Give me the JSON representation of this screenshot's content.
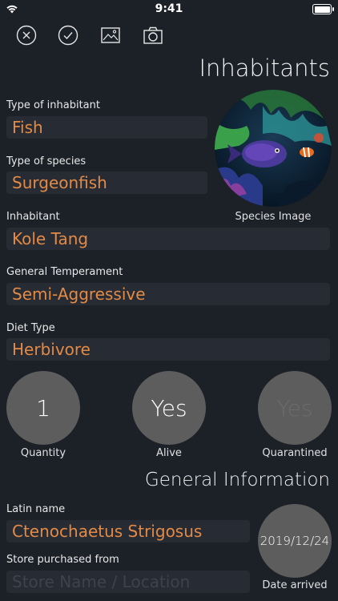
{
  "status_bar": {
    "time": "9:41"
  },
  "toolbar": {
    "icons": [
      "close-icon",
      "check-icon",
      "image-icon",
      "camera-icon"
    ]
  },
  "page": {
    "title": "Inhabitants"
  },
  "species_image": {
    "caption": "Species Image"
  },
  "fields": {
    "inhabitant_type": {
      "label": "Type of inhabitant",
      "value": "Fish"
    },
    "species_type": {
      "label": "Type of species",
      "value": "Surgeonfish"
    },
    "inhabitant": {
      "label": "Inhabitant",
      "value": "Kole Tang"
    },
    "temperament": {
      "label": "General Temperament",
      "value": "Semi-Aggressive"
    },
    "diet": {
      "label": "Diet Type",
      "value": "Herbivore"
    }
  },
  "stats": {
    "quantity": {
      "value": "1",
      "caption": "Quantity"
    },
    "alive": {
      "value": "Yes",
      "caption": "Alive"
    },
    "quarantined": {
      "value": "Yes",
      "caption": "Quarantined"
    }
  },
  "general": {
    "title": "General Information",
    "latin_name": {
      "label": "Latin name",
      "value": "Ctenochaetus Strigosus"
    },
    "store": {
      "label": "Store purchased from",
      "placeholder": "Store Name / Location"
    },
    "date_arrived": {
      "value": "2019/12/24",
      "caption": "Date arrived"
    }
  },
  "colors": {
    "accent": "#e38a45",
    "background": "#1c2027",
    "field_bg": "#262b34",
    "circle_bg": "#5d5d5d"
  }
}
